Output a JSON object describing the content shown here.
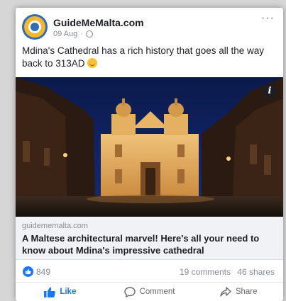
{
  "post": {
    "page_name": "GuideMeMalta.com",
    "date": "09 Aug",
    "date_separator": "·",
    "caption": "Mdina's Cathedral has a rich history that goes all the way back to 313AD",
    "more_label": "···"
  },
  "link": {
    "domain": "guidememalta.com",
    "title": "A Maltese architectural marvel! Here's all your need to know about Mdina's impressive cathedral",
    "info_label": "i"
  },
  "stats": {
    "reactions": "849",
    "comments": "19 comments",
    "shares": "46 shares"
  },
  "actions": {
    "like": "Like",
    "comment": "Comment",
    "share": "Share"
  },
  "colors": {
    "accent": "#1877f2",
    "secondary_text": "#8a8d91",
    "link_box_bg": "#f0f2f5"
  },
  "icons": [
    "avatar-logo",
    "globe-icon",
    "more-icon",
    "emoji-icon",
    "info-icon",
    "like-reaction-icon",
    "thumbs-up-icon",
    "comment-icon",
    "share-icon"
  ]
}
